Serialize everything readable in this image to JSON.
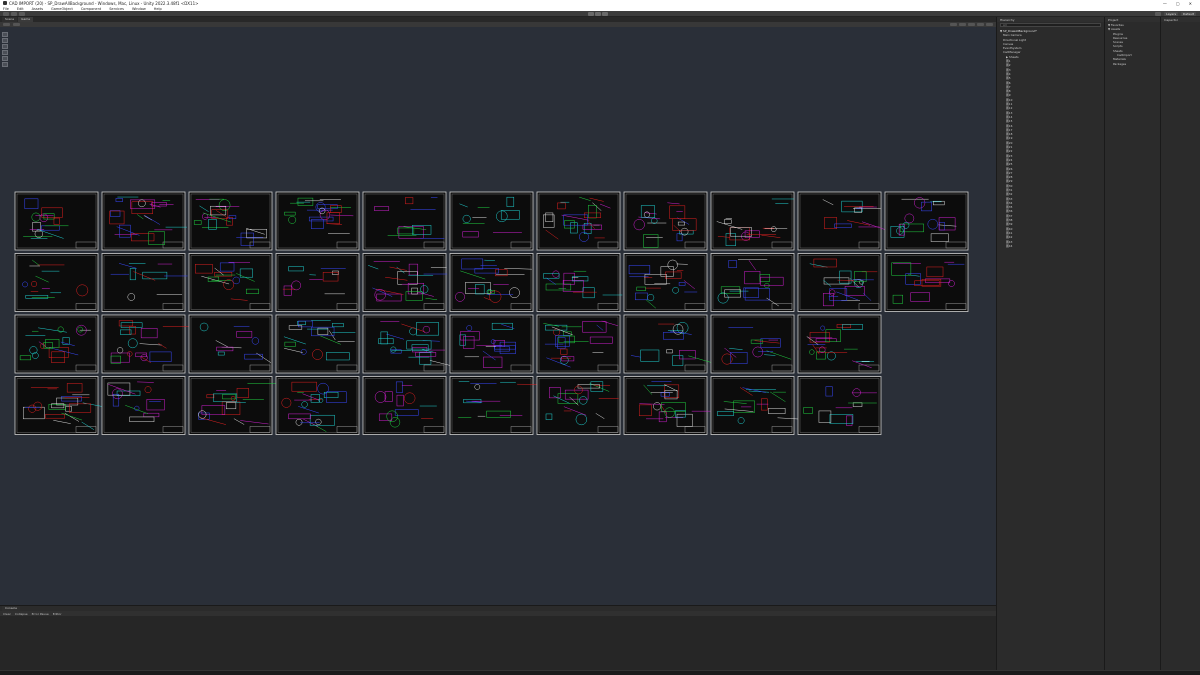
{
  "window": {
    "title": "CAD IMPORT (20) - SP_DrawAllBackground - Windows, Mac, Linux - Unity 2022.3.48f1 <DX11>",
    "controls": [
      "—",
      "▢",
      "✕"
    ]
  },
  "menu": [
    "File",
    "Edit",
    "Assets",
    "GameObject",
    "Component",
    "Services",
    "Window",
    "Help"
  ],
  "toolbar": {
    "layers_label": "Layers",
    "layout_label": "Default"
  },
  "scene": {
    "tabs": [
      "Scene",
      "Game"
    ],
    "shading_label": "Shaded",
    "mode_label": "2D"
  },
  "console": {
    "tab": "Console",
    "buttons": [
      "Clear",
      "Collapse",
      "Error Pause",
      "Editor"
    ]
  },
  "hierarchy": {
    "tab": "Hierarchy",
    "search_placeholder": "All",
    "items": [
      "▼ SP_DrawAllBackground*",
      "Main Camera",
      "Directional Light",
      "Canvas",
      "EventSystem",
      "CadManager",
      "▶ Sheets",
      "图1",
      "图2",
      "图3",
      "图4",
      "图5",
      "图6",
      "图7",
      "图8",
      "图9",
      "图10",
      "图11",
      "图12",
      "图13",
      "图14",
      "图15",
      "图16",
      "图17",
      "图18",
      "图19",
      "图20",
      "图21",
      "图22",
      "图23",
      "图24",
      "图25",
      "图26",
      "图27",
      "图28",
      "图29",
      "图30",
      "图31",
      "图32",
      "图33",
      "图34",
      "图35",
      "图36",
      "图37",
      "图38",
      "图39",
      "图40",
      "图41",
      "图42",
      "图43",
      "图44"
    ]
  },
  "project": {
    "tab": "Project",
    "items": [
      "▼ Favorites",
      "▼ Assets",
      "Plugins",
      "Resources",
      "Scenes",
      "Scripts",
      "Sheets",
      "CadImport",
      "Materials",
      "Packages"
    ]
  },
  "inspector": {
    "tab": "Inspector"
  },
  "sheets": {
    "rows": [
      11,
      11,
      10,
      10
    ],
    "accent_colors": {
      "red": "#e02020",
      "blue": "#3a4aff",
      "green": "#20d040",
      "magenta": "#d020d0",
      "cyan": "#20d0d0",
      "white": "#dddddd"
    }
  }
}
